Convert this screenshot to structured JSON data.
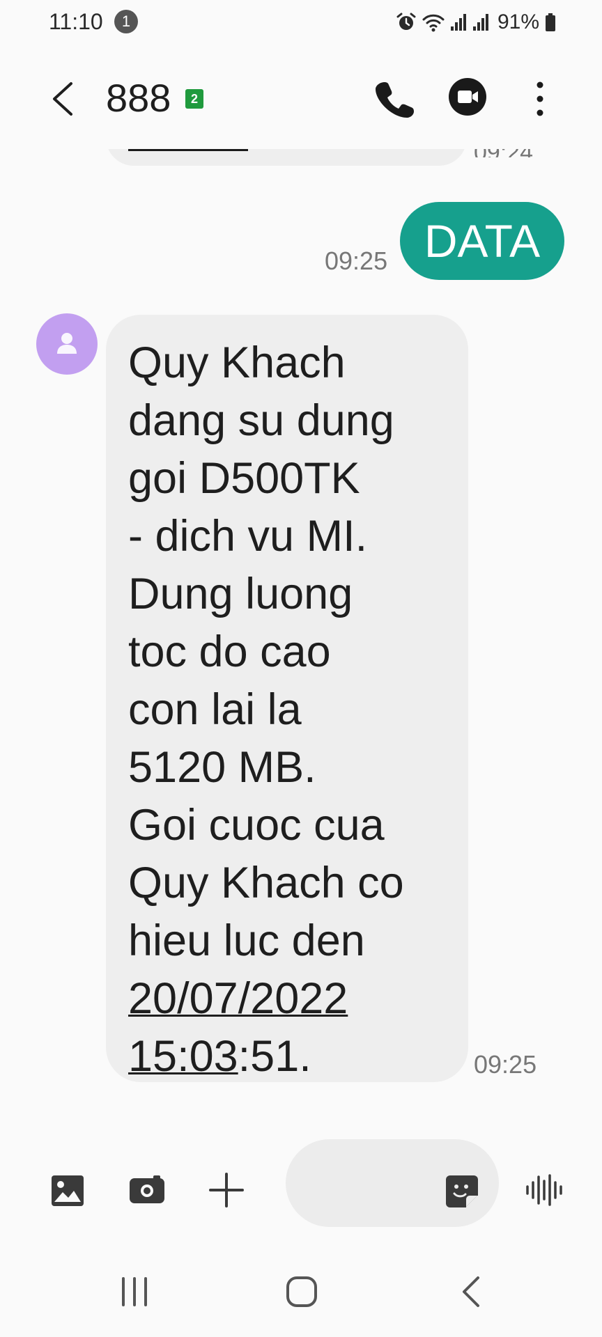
{
  "status_bar": {
    "time": "11:10",
    "notification_count": "1",
    "battery": "91%"
  },
  "header": {
    "contact": "888",
    "sim_label": "2"
  },
  "messages": {
    "previous_time": "09:24",
    "outgoing": {
      "text": "DATA",
      "time": "09:25"
    },
    "incoming": {
      "lines": [
        "Quy Khach",
        "dang su dung",
        "goi D500TK",
        "- dich vu MI.",
        "Dung luong",
        "toc do cao",
        "con lai la",
        "5120 MB.",
        "Goi cuoc cua",
        "Quy Khach co",
        "hieu luc den"
      ],
      "date_link": "20/07/2022",
      "time_link": "15:03",
      "time_rest": ":51.",
      "time": "09:25"
    }
  },
  "colors": {
    "outgoing_bubble": "#16a08d",
    "incoming_bubble": "#eeeeee",
    "avatar": "#c29ff0",
    "sim_badge": "#1f9a3d",
    "background": "#fafafa"
  },
  "icons": {
    "back": "chevron-left-icon",
    "call": "phone-icon",
    "video": "video-call-icon",
    "more": "more-vert-icon",
    "gallery": "gallery-icon",
    "camera": "camera-icon",
    "attach": "plus-icon",
    "sticker": "sticker-icon",
    "voice": "voice-waveform-icon"
  }
}
